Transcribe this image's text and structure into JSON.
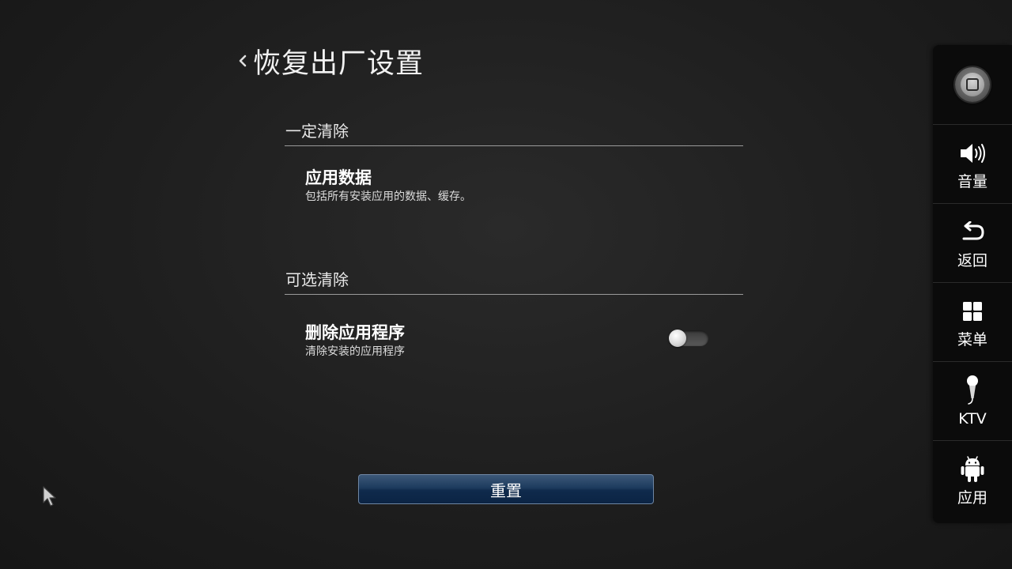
{
  "header": {
    "title": "恢复出厂设置",
    "back_icon": "chevron-left-icon"
  },
  "sections": [
    {
      "heading": "一定清除",
      "items": [
        {
          "title": "应用数据",
          "description": "包括所有安装应用的数据、缓存。"
        }
      ]
    },
    {
      "heading": "可选清除",
      "items": [
        {
          "title": "删除应用程序",
          "description": "清除安装的应用程序",
          "toggle_on": false
        }
      ]
    }
  ],
  "reset_button": {
    "label": "重置"
  },
  "side_panel": {
    "items": [
      {
        "icon": "home-icon",
        "label": ""
      },
      {
        "icon": "volume-icon",
        "label": "音量"
      },
      {
        "icon": "back-arrow-icon",
        "label": "返回"
      },
      {
        "icon": "menu-grid-icon",
        "label": "菜单"
      },
      {
        "icon": "microphone-icon",
        "label": "KTV"
      },
      {
        "icon": "android-icon",
        "label": "应用"
      }
    ]
  },
  "colors": {
    "background": "#1e1e1e",
    "button_top": "#3c5878",
    "button_bottom": "#0b2444",
    "panel": "#0b0b0b"
  }
}
